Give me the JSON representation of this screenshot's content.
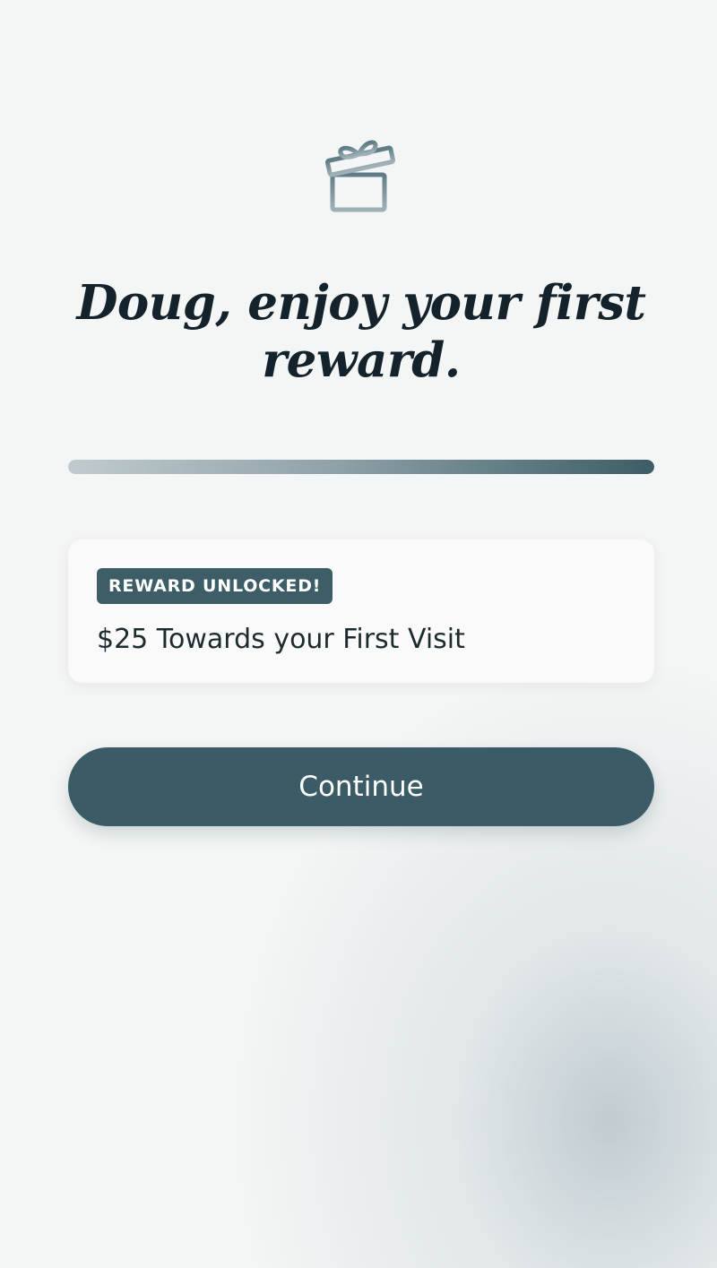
{
  "colors": {
    "background": "#f4f5f5",
    "accent": "#3b5c66",
    "title_text": "#14232b",
    "card_background": "#fafafa",
    "progress_start": "#c0cbce",
    "progress_end": "#3c5d67"
  },
  "header": {
    "icon": "gift-icon",
    "title": "Doug, enjoy your first reward."
  },
  "progress": {
    "value_fraction": 1.0
  },
  "reward": {
    "badge": "REWARD UNLOCKED!",
    "description": "$25 Towards your First Visit"
  },
  "actions": {
    "continue_label": "Continue"
  }
}
